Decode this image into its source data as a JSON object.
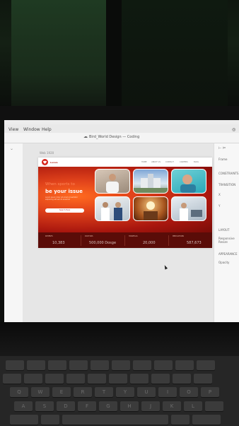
{
  "app": {
    "menu": [
      "View",
      "Window",
      "Help"
    ],
    "document_title": "Bird_World Design — Coding",
    "frame_label": "Web 1920",
    "right_panel": {
      "items": [
        "Frame",
        "CONSTRAINTS",
        "TRANSITION",
        "X",
        "Y",
        "LAYOUT",
        "Responsive Resize",
        "APPEARANCE",
        "Opacity"
      ]
    }
  },
  "website": {
    "brand": "Lorem",
    "nav": [
      "HOME",
      "ABOUT US",
      "CONTACT",
      "CAREERS",
      "BLOG"
    ],
    "hero": {
      "title_line1": "When sports to",
      "title_line2": "be your issue",
      "description": "Lorem ipsum dolor sit amet consectetur adipiscing elit sed do eiusmod",
      "button": "Search Here"
    },
    "stats": [
      {
        "label": "PATIENTS",
        "value": "10,383"
      },
      {
        "label": "DOCTORS",
        "value": "500,000 Dosge"
      },
      {
        "label": "HOSPITALS",
        "value": "20,000"
      },
      {
        "label": "MEDICATIONS",
        "value": "587,673"
      }
    ]
  },
  "keyboard": {
    "row1": [
      "",
      "",
      "",
      "",
      "",
      "",
      "",
      "",
      "",
      ""
    ],
    "row2": [
      "",
      "",
      "",
      "",
      "",
      "",
      "",
      "",
      "",
      ""
    ],
    "row3": [
      "Q",
      "W",
      "E",
      "R",
      "T",
      "Y",
      "U",
      "I",
      "O",
      "P"
    ],
    "row4": [
      "A",
      "S",
      "D",
      "F",
      "G",
      "H",
      "J",
      "K",
      "L",
      ""
    ]
  },
  "colors": {
    "hero_primary": "#e1431b",
    "hero_dark": "#7a0c08",
    "stats_bar": "#5a0c08",
    "accent_text": "#ff8a5c"
  }
}
